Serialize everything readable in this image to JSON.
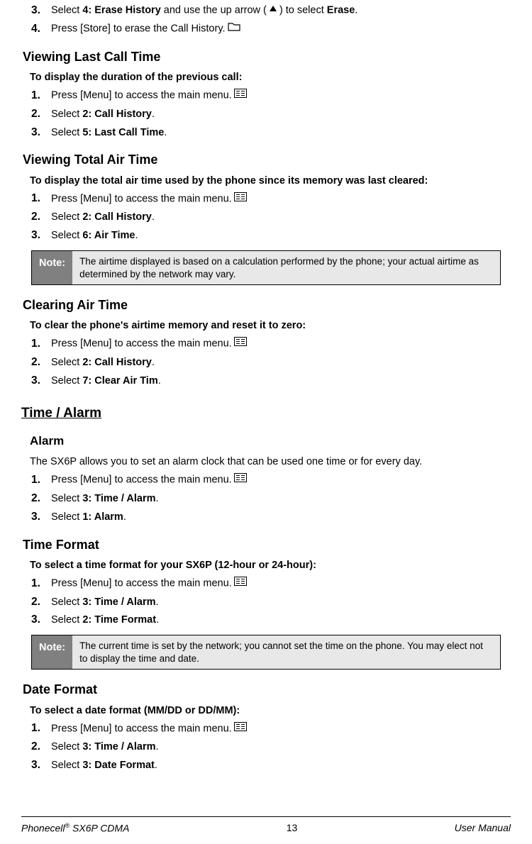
{
  "sections": [
    {
      "type": "steps_continue",
      "items": [
        {
          "n": "3.",
          "pre": "Select ",
          "b1": "4: Erase History",
          "mid": " and use the up arrow (",
          "icon": "up",
          "mid2": ") to select ",
          "b2": "Erase",
          "post": "."
        },
        {
          "n": "4.",
          "pre": "Press ",
          "icon": "folder",
          "mid": " [Store] to erase the Call History."
        }
      ]
    },
    {
      "type": "h2",
      "text": "Viewing Last Call Time"
    },
    {
      "type": "intro",
      "text": "To display the duration of the previous call:"
    },
    {
      "type": "steps",
      "items": [
        {
          "n": "1.",
          "pre": "Press ",
          "icon": "menu",
          "mid": " [Menu] to access the main menu."
        },
        {
          "n": "2.",
          "pre": "Select ",
          "b1": "2: Call History",
          "post": "."
        },
        {
          "n": "3.",
          "pre": "Select ",
          "b1": "5: Last Call Time",
          "post": "."
        }
      ]
    },
    {
      "type": "h2",
      "text": "Viewing Total Air Time"
    },
    {
      "type": "intro",
      "text": "To display the total air time used by the phone since its memory was last cleared:"
    },
    {
      "type": "steps",
      "items": [
        {
          "n": "1.",
          "pre": "Press ",
          "icon": "menu",
          "mid": " [Menu] to access the main menu."
        },
        {
          "n": "2.",
          "pre": "Select ",
          "b1": "2: Call History",
          "post": "."
        },
        {
          "n": "3.",
          "pre": "Select ",
          "b1": "6: Air Time",
          "post": "."
        }
      ]
    },
    {
      "type": "note",
      "label": "Note:",
      "body": "The airtime displayed is based on a calculation performed by the phone; your actual airtime as determined by the network may vary."
    },
    {
      "type": "h2",
      "text": "Clearing Air Time"
    },
    {
      "type": "intro",
      "text": "To clear the phone's airtime memory and reset it to zero:"
    },
    {
      "type": "steps",
      "items": [
        {
          "n": "1.",
          "pre": "Press ",
          "icon": "menu",
          "mid": " [Menu] to access the main menu."
        },
        {
          "n": "2.",
          "pre": "Select ",
          "b1": "2: Call History",
          "post": "."
        },
        {
          "n": "3.",
          "pre": "Select ",
          "b1": "7: Clear Air Tim",
          "post": "."
        }
      ]
    },
    {
      "type": "h1",
      "text": "Time / Alarm"
    },
    {
      "type": "h2",
      "text": "Alarm",
      "indent": true
    },
    {
      "type": "para",
      "text": "The SX6P allows you to set an alarm clock that can be used one time or for every day."
    },
    {
      "type": "steps",
      "items": [
        {
          "n": "1.",
          "pre": "Press ",
          "icon": "menu",
          "mid": " [Menu] to access the main menu."
        },
        {
          "n": "2.",
          "pre": "Select ",
          "b1": "3: Time / Alarm",
          "post": "."
        },
        {
          "n": "3.",
          "pre": "Select ",
          "b1": "1: Alarm",
          "post": "."
        }
      ]
    },
    {
      "type": "h2",
      "text": "Time Format"
    },
    {
      "type": "intro",
      "text": "To select a time format for your SX6P (12-hour or 24-hour):"
    },
    {
      "type": "steps",
      "items": [
        {
          "n": "1.",
          "pre": "Press ",
          "icon": "menu",
          "mid": " [Menu] to access the main menu."
        },
        {
          "n": "2.",
          "pre": "Select ",
          "b1": "3: Time / Alarm",
          "post": "."
        },
        {
          "n": "3.",
          "pre": "Select ",
          "b1": "2: Time Format",
          "post": "."
        }
      ]
    },
    {
      "type": "note",
      "label": "Note:",
      "body": "The current time is set by the network; you cannot set the time on the phone. You may elect not to display the time and date."
    },
    {
      "type": "h2",
      "text": "Date Format"
    },
    {
      "type": "intro",
      "text": "To select a date format (MM/DD or DD/MM):"
    },
    {
      "type": "steps",
      "items": [
        {
          "n": "1.",
          "pre": "Press ",
          "icon": "menu",
          "mid": " [Menu] to access the main menu."
        },
        {
          "n": "2.",
          "pre": "Select ",
          "b1": "3: Time / Alarm",
          "post": "."
        },
        {
          "n": "3.",
          "pre": "Select ",
          "b1": "3: Date Format",
          "post": "."
        }
      ]
    }
  ],
  "footer": {
    "left_pre": "Phonecell",
    "left_reg": "®",
    "left_post": " SX6P CDMA",
    "center": "13",
    "right": "User Manual"
  },
  "icons": {
    "menu": "menu-icon",
    "folder": "folder-icon",
    "up": "up-arrow-icon"
  }
}
